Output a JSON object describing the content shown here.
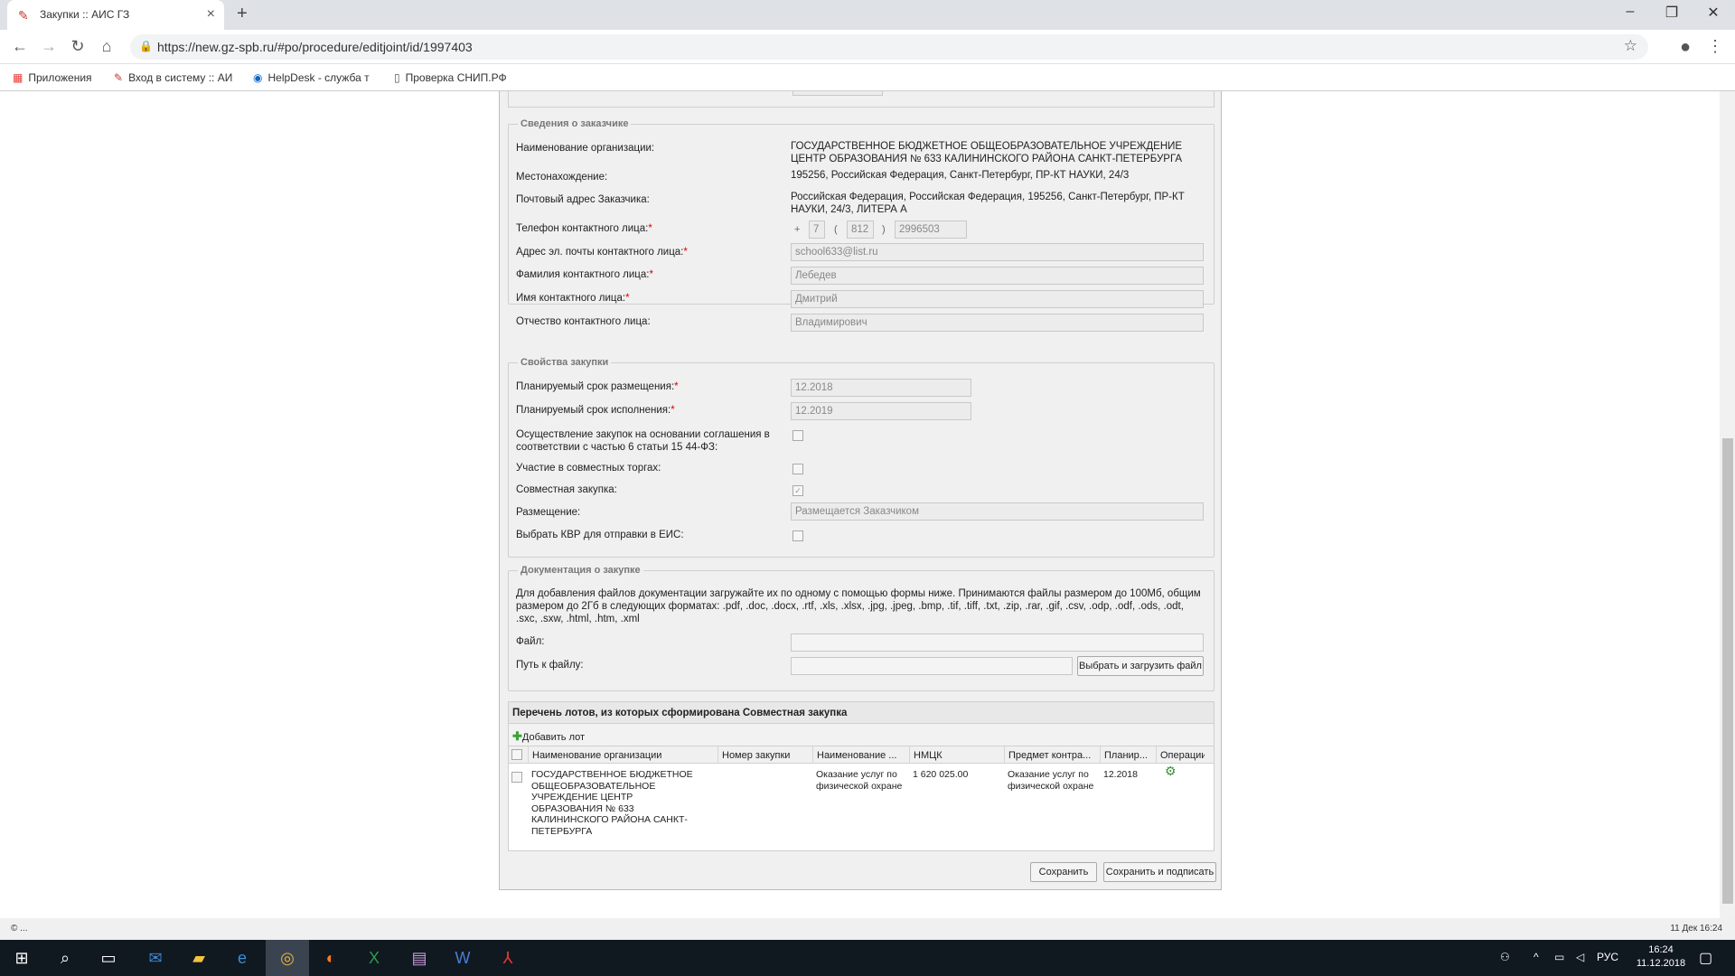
{
  "browser": {
    "tab_title": "Закупки :: АИС ГЗ",
    "url": "https://new.gz-spb.ru/#po/procedure/editjoint/id/1997403",
    "bookmarks": [
      "Приложения",
      "Вход в систему :: АИ",
      "HelpDesk - служба т",
      "Проверка СНИП.РФ"
    ]
  },
  "customer": {
    "legend": "Сведения о заказчике",
    "org_label": "Наименование организации:",
    "org_value": "ГОСУДАРСТВЕННОЕ БЮДЖЕТНОЕ ОБЩЕОБРАЗОВАТЕЛЬНОЕ УЧРЕЖДЕНИЕ ЦЕНТР ОБРАЗОВАНИЯ № 633 КАЛИНИНСКОГО РАЙОНА САНКТ-ПЕТЕРБУРГА",
    "location_label": "Местонахождение:",
    "location_value": "195256, Российская Федерация, Санкт-Петербург, ПР-КТ НАУКИ, 24/3",
    "postal_label": "Почтовый адрес Заказчика:",
    "postal_value": "Российская Федерация, Российская Федерация, 195256, Санкт-Петербург, ПР-КТ НАУКИ, 24/3, ЛИТЕРА А",
    "phone_label": "Телефон контактного лица:",
    "phone_plus": "+",
    "phone_country": "7",
    "phone_open": "(",
    "phone_code": "812",
    "phone_close": ")",
    "phone_number": "2996503",
    "email_label": "Адрес эл. почты контактного лица:",
    "email_value": "school633@list.ru",
    "lastname_label": "Фамилия контактного лица:",
    "lastname_value": "Лебедев",
    "firstname_label": "Имя контактного лица:",
    "firstname_value": "Дмитрий",
    "patronymic_label": "Отчество контактного лица:",
    "patronymic_value": "Владимирович",
    "required_mark": "*"
  },
  "props": {
    "legend": "Свойства закупки",
    "placement_term_label": "Планируемый срок размещения:",
    "placement_term_value": "12.2018",
    "execution_term_label": "Планируемый срок исполнения:",
    "execution_term_value": "12.2019",
    "agreement_label": "Осуществление закупок на основании соглашения в соответствии с частью 6 статьи 15 44-ФЗ:",
    "joint_trade_label": "Участие в совместных торгах:",
    "joint_purchase_label": "Совместная закупка:",
    "placement_label": "Размещение:",
    "placement_value": "Размещается Заказчиком",
    "kvr_label": "Выбрать КВР для отправки в ЕИС:"
  },
  "docs": {
    "legend": "Документация о закупке",
    "info": "Для добавления файлов документации загружайте их по одному с помощью формы ниже. Принимаются файлы размером до 100Мб, общим размером до 2Гб в следующих форматах: .pdf, .doc, .docx, .rtf, .xls, .xlsx, .jpg, .jpeg, .bmp, .tif, .tiff, .txt, .zip, .rar, .gif, .csv, .odp, .odf, .ods, .odt, .sxc, .sxw, .html, .htm, .xml",
    "file_label": "Файл:",
    "path_label": "Путь к файлу:",
    "upload_button": "Выбрать и загрузить файл"
  },
  "lots": {
    "title": "Перечень лотов, из которых сформирована Совместная закупка",
    "add_button": "Добавить лот",
    "columns": [
      "Наименование организации",
      "Номер закупки",
      "Наименование ...",
      "НМЦК",
      "Предмет контра...",
      "Планир...",
      "Операции"
    ],
    "rows": [
      {
        "org": "ГОСУДАРСТВЕННОЕ БЮДЖЕТНОЕ ОБЩЕОБРАЗОВАТЕЛЬНОЕ УЧРЕЖДЕНИЕ ЦЕНТР ОБРАЗОВАНИЯ № 633 КАЛИНИНСКОГО РАЙОНА САНКТ-ПЕТЕРБУРГА",
        "number": "",
        "name": "Оказание услуг по физической охране",
        "nmck": "1 620 025.00",
        "subject": "Оказание услуг по физической охране",
        "planned": "12.2018"
      }
    ]
  },
  "actions": {
    "save": "Сохранить",
    "save_sign": "Сохранить и подписать"
  },
  "statusbar": {
    "left": "© ...",
    "right": "11 Дек 16:24"
  },
  "taskbar": {
    "lang": "РУС",
    "time": "16:24",
    "date": "11.12.2018"
  }
}
